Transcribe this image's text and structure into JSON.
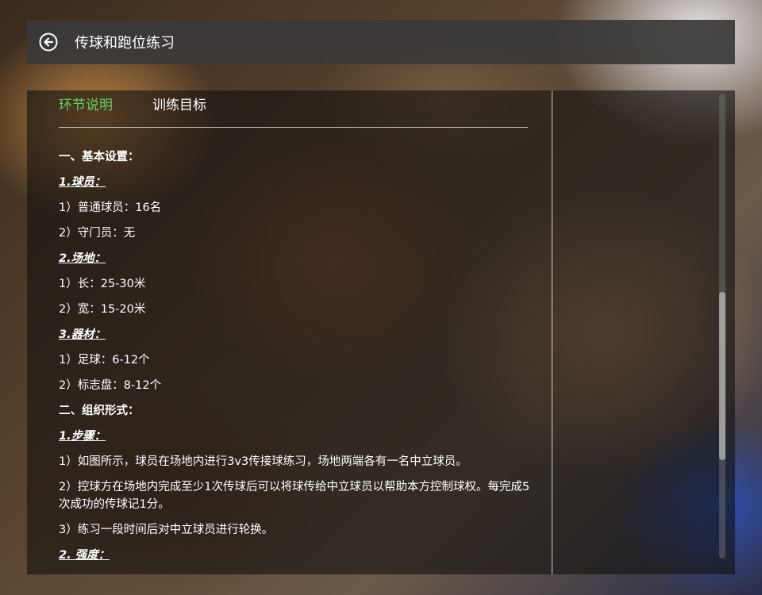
{
  "header": {
    "title": "传球和跑位练习",
    "back_icon": "back-arrow-circle-icon"
  },
  "tabs": [
    {
      "label": "环节说明",
      "active": true
    },
    {
      "label": "训练目标",
      "active": false
    }
  ],
  "colors": {
    "active_tab": "#5fd35f",
    "text": "#ffffff",
    "titlebar": "#3a3a3a"
  },
  "content": {
    "lines": [
      {
        "type": "heading",
        "text": "一、基本设置："
      },
      {
        "type": "sub",
        "text": "1.球员："
      },
      {
        "type": "text",
        "text": "1）普通球员：16名"
      },
      {
        "type": "text",
        "text": "2）守门员：无"
      },
      {
        "type": "sub",
        "text": "2.场地："
      },
      {
        "type": "text",
        "text": "1）长：25-30米"
      },
      {
        "type": "text",
        "text": "2）宽：15-20米"
      },
      {
        "type": "sub",
        "text": "3.器材："
      },
      {
        "type": "text",
        "text": "1）足球：6-12个"
      },
      {
        "type": "text",
        "text": "2）标志盘：8-12个"
      },
      {
        "type": "heading",
        "text": " 二、组织形式："
      },
      {
        "type": "sub",
        "text": "1.步骤："
      },
      {
        "type": "text",
        "text": "1）如图所示，球员在场地内进行3v3传接球练习，场地两端各有一名中立球员。"
      },
      {
        "type": "wrap",
        "text": "2）控球方在场地内完成至少1次传球后可以将球传给中立球员以帮助本方控制球权。每完成5次成功的传球记1分。"
      },
      {
        "type": "text",
        "text": "3）练习一段时间后对中立球员进行轮换。"
      },
      {
        "type": "sub",
        "text": "2. 强度："
      }
    ]
  }
}
